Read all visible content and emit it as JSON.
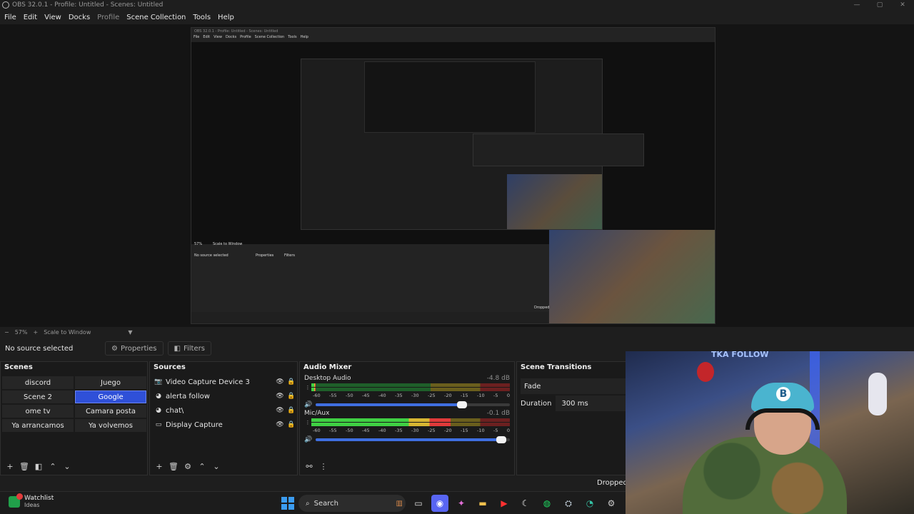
{
  "window": {
    "title": "OBS 32.0.1 - Profile: Untitled - Scenes: Untitled",
    "controls": [
      "—",
      "▢",
      "✕"
    ]
  },
  "menu": [
    "File",
    "Edit",
    "View",
    "Docks",
    "Profile",
    "Scene Collection",
    "Tools",
    "Help"
  ],
  "nested_preview": {
    "title": "OBS 32.0.1 - Profile: Untitled - Scenes: Untitled",
    "menu": [
      "File",
      "Edit",
      "View",
      "Docks",
      "Profile",
      "Scene Collection",
      "Tools",
      "Help"
    ],
    "zoom": "57%",
    "scale_mode": "Scale to Window",
    "no_source": "No source selected",
    "properties": "Properties",
    "filters": "Filters",
    "dropped": "Dropped"
  },
  "zoom": {
    "value": "57%",
    "scale_mode": "Scale to Window"
  },
  "toolbar": {
    "no_source": "No source selected",
    "properties": "Properties",
    "filters": "Filters"
  },
  "scenes": {
    "title": "Scenes",
    "items": [
      {
        "label": "discord",
        "active": false
      },
      {
        "label": "Juego",
        "active": false
      },
      {
        "label": "Scene 2",
        "active": false
      },
      {
        "label": "Google",
        "active": true
      },
      {
        "label": "ome tv",
        "active": false
      },
      {
        "label": "Camara posta",
        "active": false
      },
      {
        "label": "Ya arrancamos",
        "active": false
      },
      {
        "label": "Ya volvemos",
        "active": false
      }
    ]
  },
  "sources": {
    "title": "Sources",
    "items": [
      {
        "label": "Video Capture Device 3",
        "icon": "camera-icon"
      },
      {
        "label": "alerta follow",
        "icon": "browser-icon"
      },
      {
        "label": "chat\\",
        "icon": "browser-icon"
      },
      {
        "label": "Display Capture",
        "icon": "monitor-icon"
      }
    ]
  },
  "mixer": {
    "title": "Audio Mixer",
    "ticks": [
      "-60",
      "-55",
      "-50",
      "-45",
      "-40",
      "-35",
      "-30",
      "-25",
      "-20",
      "-15",
      "-10",
      "-5",
      "0"
    ],
    "channels": [
      {
        "name": "Desktop Audio",
        "db": "-4.8 dB",
        "level": 0.02,
        "volume": 0.78
      },
      {
        "name": "Mic/Aux",
        "db": "-0.1 dB",
        "level": 0.7,
        "volume": 0.98
      }
    ]
  },
  "transitions": {
    "title": "Scene Transitions",
    "selected": "Fade",
    "duration_label": "Duration",
    "duration_value": "300 ms"
  },
  "status": {
    "dropped": "Dropped"
  },
  "webcam": {
    "banner": "TKA FOLLOW",
    "cap_letter": "B"
  },
  "taskbar": {
    "widget_title": "Watchlist",
    "widget_sub": "Ideas",
    "search": "Search",
    "apps": [
      "folder-icon",
      "task-view-icon",
      "discord-icon",
      "copilot-icon",
      "files-icon",
      "youtube-icon",
      "app-icon",
      "spotify-icon",
      "steam-icon",
      "edge-icon",
      "settings-icon",
      "obs-icon"
    ]
  },
  "colors": {
    "accent": "#2f50d8",
    "meter_green": "#3fd043",
    "meter_yellow": "#d7b632",
    "meter_red": "#e03a3a"
  }
}
